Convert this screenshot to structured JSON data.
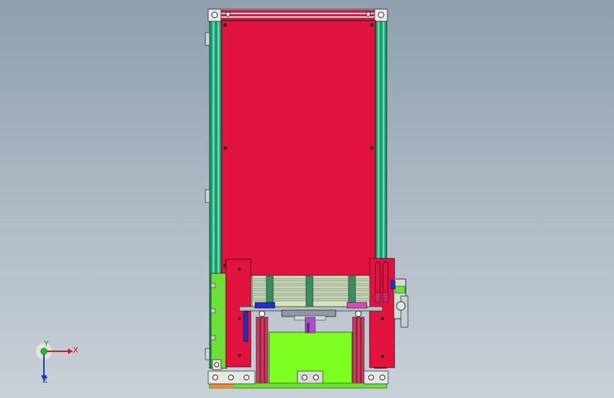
{
  "colors": {
    "panel_red": "#e2133f",
    "frame_green": "#1c9b73",
    "slot_light": "#5fd7a5",
    "plate_green": "#6ede3a",
    "base_lime": "#7cff21",
    "roller_pink": "#cf3f62",
    "guide_blue": "#2230c8",
    "accent_orange": "#f08a2a",
    "bolt_dark": "#1a1a1a"
  },
  "triad": {
    "x_label": "X",
    "y_label": "Y",
    "z_label": "Z"
  }
}
